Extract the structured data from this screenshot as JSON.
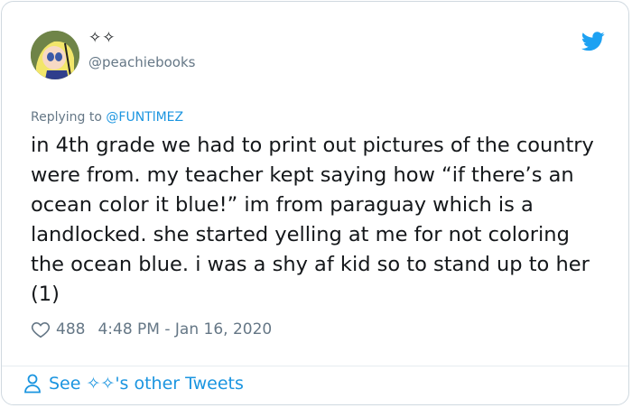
{
  "author": {
    "display_name": "✧✧",
    "handle": "@peachiebooks"
  },
  "reply": {
    "prefix": "Replying to ",
    "mention": "@FUNTlMEZ"
  },
  "tweet": {
    "text": "in 4th grade we had to print out pictures of the country were from. my teacher kept saying how “if there’s an ocean color it blue!” im from paraguay which is a landlocked. she started yelling at me for not coloring the ocean blue. i was a shy af kid so to stand up to her (1)",
    "likes": "488",
    "timestamp": "4:48 PM - Jan 16, 2020"
  },
  "footer": {
    "link_label": "See ✧✧'s other Tweets"
  },
  "icons": {
    "brand": "twitter-bird-icon",
    "like": "heart-icon",
    "profile": "person-icon"
  },
  "colors": {
    "brand_blue": "#1da1f2",
    "link_blue": "#1b95e0",
    "text": "#14171a",
    "muted": "#657786"
  }
}
